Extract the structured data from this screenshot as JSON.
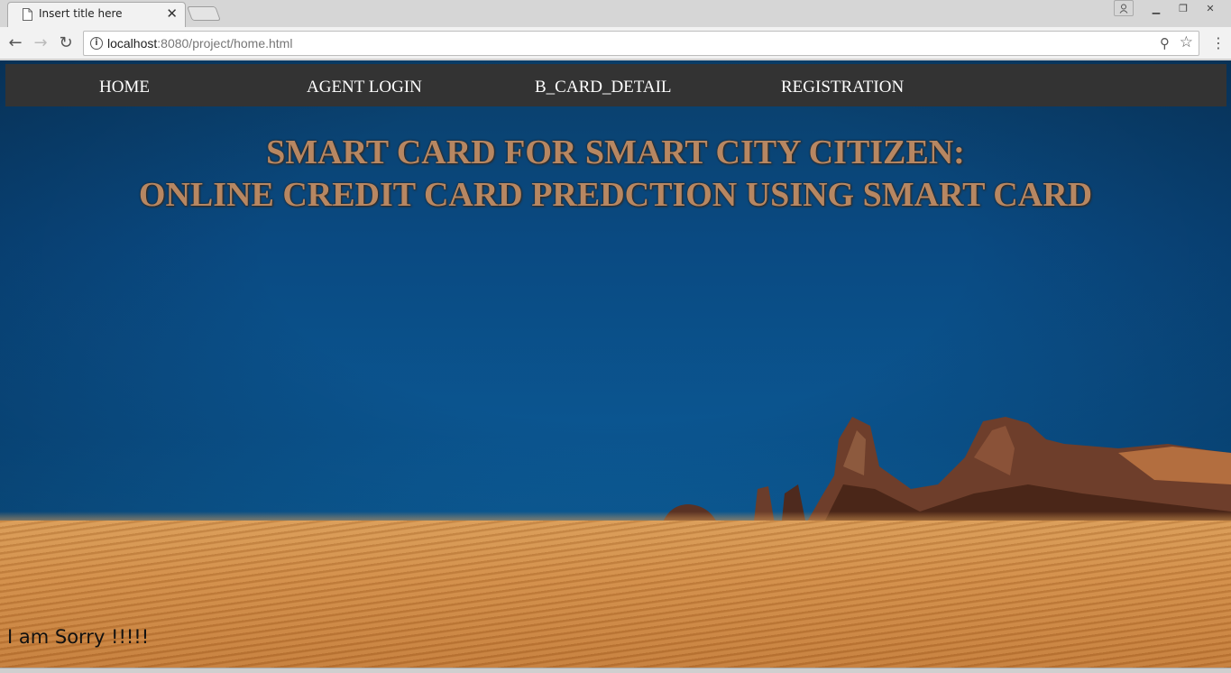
{
  "browser": {
    "tab_title": "Insert title here",
    "url_host": "localhost",
    "url_rest": ":8080/project/home.html"
  },
  "nav": {
    "items": [
      {
        "label": "HOME"
      },
      {
        "label": "AGENT LOGIN"
      },
      {
        "label": "B_CARD_DETAIL"
      },
      {
        "label": "REGISTRATION"
      }
    ]
  },
  "page": {
    "title_line1": "SMART CARD FOR SMART CITY CITIZEN:",
    "title_line2": "ONLINE CREDIT CARD PREDCTION USING SMART CARD",
    "message": "I am Sorry !!!!!"
  },
  "colors": {
    "nav_bg": "#333333",
    "title_color": "#b78762",
    "sky": "#0a4a82",
    "sand": "#d89a55"
  }
}
